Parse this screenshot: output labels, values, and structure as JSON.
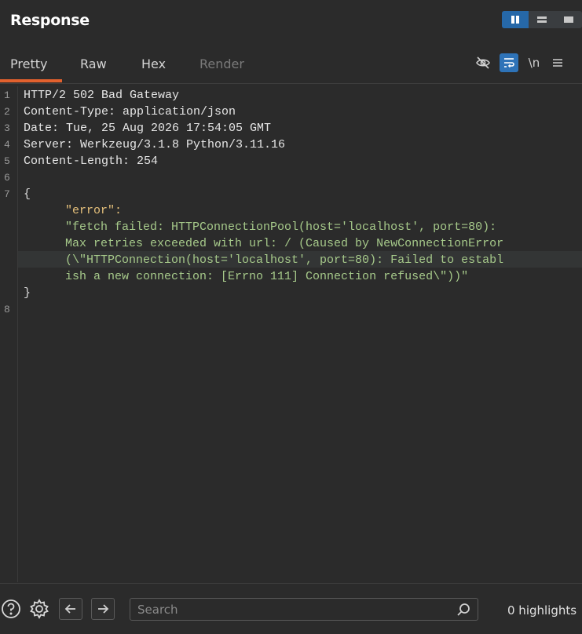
{
  "header": {
    "title": "Response"
  },
  "tabs": [
    {
      "label": "Pretty"
    },
    {
      "label": "Raw"
    },
    {
      "label": "Hex"
    },
    {
      "label": "Render"
    }
  ],
  "toolbar": {
    "newline_label": "\\n"
  },
  "editor": {
    "line_numbers": [
      "1",
      "2",
      "3",
      "4",
      "5",
      "6",
      "7",
      "8"
    ],
    "lines": [
      "HTTP/2 502 Bad Gateway",
      "Content-Type: application/json",
      "Date: Tue, 25 Aug 2026 17:54:05 GMT",
      "Server: Werkzeug/3.1.8 Python/3.11.16",
      "Content-Length: 254"
    ],
    "open_brace": "{",
    "json_key": "\"error\":",
    "json_value_lines": [
      "\"fetch failed: HTTPConnectionPool(host='localhost', port=80):",
      "Max retries exceeded with url: / (Caused by NewConnectionError",
      "(\\\"HTTPConnection(host='localhost', port=80): Failed to establ",
      "ish a new connection: [Errno 111] Connection refused\\\"))\""
    ],
    "close_brace": "}"
  },
  "footer": {
    "search_placeholder": "Search",
    "highlights": "0 highlights"
  },
  "colors": {
    "background": "#2b2b2b",
    "accent_tab": "#e2612e",
    "accent_blue": "#2e73b8",
    "json_key": "#e5c07b",
    "json_string": "#a6c98a"
  }
}
